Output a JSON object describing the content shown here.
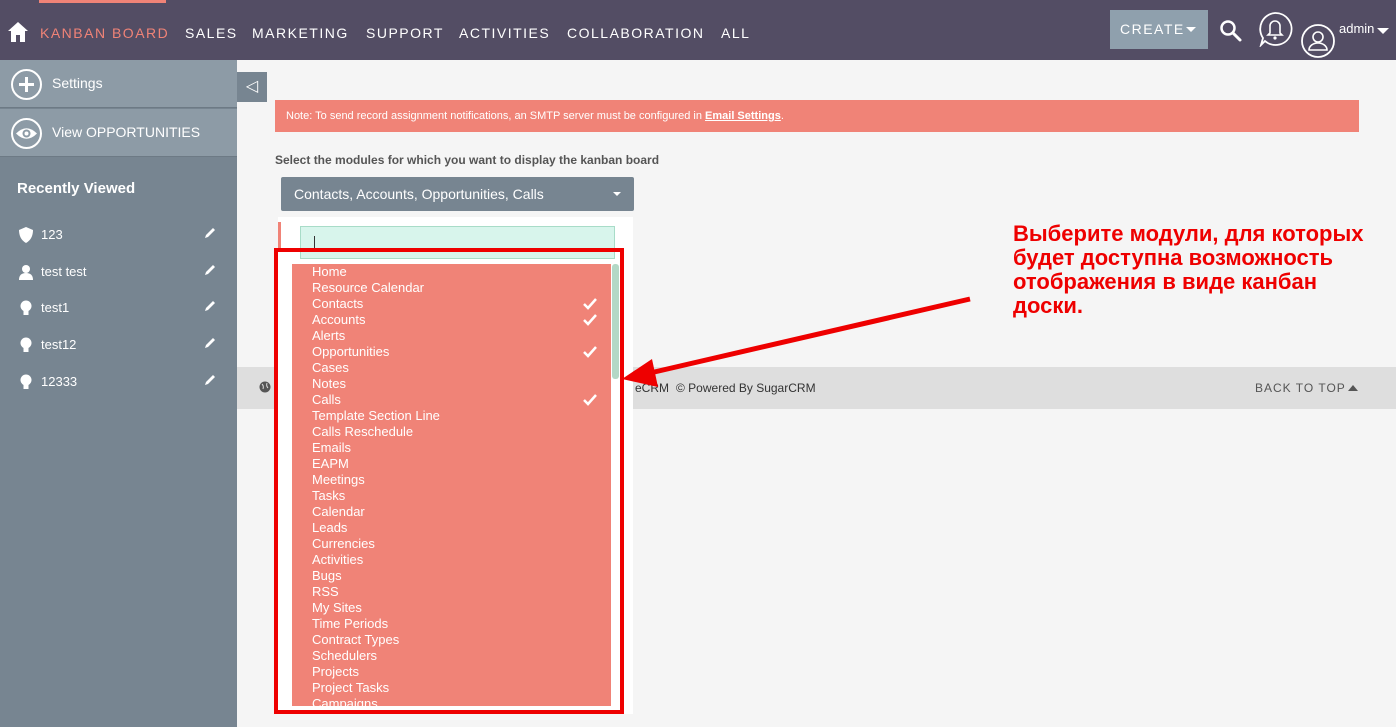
{
  "nav": {
    "items": [
      "KANBAN BOARD",
      "SALES",
      "MARKETING",
      "SUPPORT",
      "ACTIVITIES",
      "COLLABORATION",
      "ALL"
    ],
    "create_label": "CREATE",
    "user_label": "admin",
    "accent": "#f08377",
    "bg": "#534d64"
  },
  "sidebar": {
    "actions": [
      {
        "label": "Settings",
        "icon": "plus-icon"
      },
      {
        "label": "View OPPORTUNITIES",
        "icon": "eye-icon"
      }
    ],
    "recent_title": "Recently Viewed",
    "recent_items": [
      {
        "label": "123",
        "icon": "shield-icon"
      },
      {
        "label": "test test",
        "icon": "person-icon"
      },
      {
        "label": "test1",
        "icon": "lightbulb-icon"
      },
      {
        "label": "test12",
        "icon": "lightbulb-icon"
      },
      {
        "label": "12333",
        "icon": "lightbulb-icon"
      }
    ]
  },
  "main": {
    "collapse_glyph": "◁",
    "notice_text": "Note: To send record assignment notifications, an SMTP server must be configured in ",
    "notice_link": "Email Settings",
    "notice_tail": ".",
    "select_label": "Select the modules for which you want to display the kanban board",
    "select_value": "Contacts, Accounts, Opportunities, Calls",
    "search_value": ""
  },
  "modules": [
    {
      "label": "Home",
      "checked": false
    },
    {
      "label": "Resource Calendar",
      "checked": false
    },
    {
      "label": "Contacts",
      "checked": true
    },
    {
      "label": "Accounts",
      "checked": true
    },
    {
      "label": "Alerts",
      "checked": false
    },
    {
      "label": "Opportunities",
      "checked": true
    },
    {
      "label": "Cases",
      "checked": false
    },
    {
      "label": "Notes",
      "checked": false
    },
    {
      "label": "Calls",
      "checked": true
    },
    {
      "label": "Template Section Line",
      "checked": false
    },
    {
      "label": "Calls Reschedule",
      "checked": false
    },
    {
      "label": "Emails",
      "checked": false
    },
    {
      "label": "EAPM",
      "checked": false
    },
    {
      "label": "Meetings",
      "checked": false
    },
    {
      "label": "Tasks",
      "checked": false
    },
    {
      "label": "Calendar",
      "checked": false
    },
    {
      "label": "Leads",
      "checked": false
    },
    {
      "label": "Currencies",
      "checked": false
    },
    {
      "label": "Activities",
      "checked": false
    },
    {
      "label": "Bugs",
      "checked": false
    },
    {
      "label": "RSS",
      "checked": false
    },
    {
      "label": "My Sites",
      "checked": false
    },
    {
      "label": "Time Periods",
      "checked": false
    },
    {
      "label": "Contract Types",
      "checked": false
    },
    {
      "label": "Schedulers",
      "checked": false
    },
    {
      "label": "Projects",
      "checked": false
    },
    {
      "label": "Project Tasks",
      "checked": false
    },
    {
      "label": "Campaigns",
      "checked": false
    }
  ],
  "footer": {
    "suite_partial": "eCRM",
    "powered": "© Powered By SugarCRM",
    "back_to_top": "BACK TO TOP"
  },
  "annotation": {
    "text": "Выберите модули, для которых будет доступна возможность отображения в виде канбан доски.",
    "color": "#ee0000"
  }
}
